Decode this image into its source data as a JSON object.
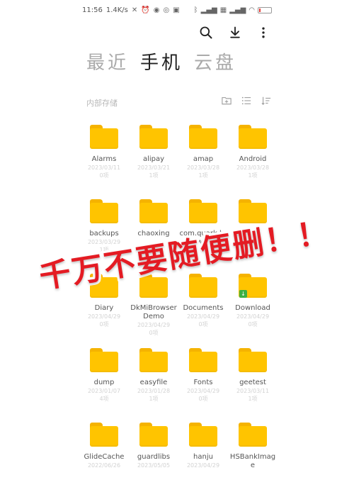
{
  "status_bar": {
    "time": "11:56",
    "speed": "1.4K/s",
    "battery_level": 0.15,
    "battery_color": "#e53935"
  },
  "actions": {
    "search_icon": "search-icon",
    "download_icon": "download-icon",
    "more_icon": "more-vertical-icon"
  },
  "tabs": [
    {
      "label": "最近",
      "active": false
    },
    {
      "label": "手机",
      "active": true
    },
    {
      "label": "云盘",
      "active": false
    }
  ],
  "storage": {
    "label": "内部存储"
  },
  "folders": [
    {
      "name": "Alarms",
      "date": "2023/03/11",
      "count": "0项",
      "badge": ""
    },
    {
      "name": "alipay",
      "date": "2023/03/21",
      "count": "1项",
      "badge": ""
    },
    {
      "name": "amap",
      "date": "2023/03/28",
      "count": "1项",
      "badge": ""
    },
    {
      "name": "Android",
      "date": "2023/03/28",
      "count": "1项",
      "badge": ""
    },
    {
      "name": "backups",
      "date": "2023/03/29",
      "count": "1项",
      "badge": ""
    },
    {
      "name": "chaoxing",
      "date": "",
      "count": "",
      "badge": ""
    },
    {
      "name": "com.quark.browser",
      "date": "",
      "count": "",
      "badge": ""
    },
    {
      "name": "",
      "date": "",
      "count": "",
      "badge": ""
    },
    {
      "name": "Diary",
      "date": "2023/04/29",
      "count": "0项",
      "badge": ""
    },
    {
      "name": "DkMiBrowserDemo",
      "date": "2023/04/29",
      "count": "0项",
      "badge": ""
    },
    {
      "name": "Documents",
      "date": "2023/04/29",
      "count": "0项",
      "badge": ""
    },
    {
      "name": "Download",
      "date": "2023/04/29",
      "count": "0项",
      "badge": "↓"
    },
    {
      "name": "dump",
      "date": "2023/01/07",
      "count": "4项",
      "badge": ""
    },
    {
      "name": "easyfile",
      "date": "2023/01/28",
      "count": "1项",
      "badge": ""
    },
    {
      "name": "Fonts",
      "date": "2023/04/29",
      "count": "0项",
      "badge": ""
    },
    {
      "name": "geetest",
      "date": "2023/03/11",
      "count": "1项",
      "badge": ""
    },
    {
      "name": "GlideCache",
      "date": "2022/06/26",
      "count": "",
      "badge": ""
    },
    {
      "name": "guardlibs",
      "date": "2023/05/05",
      "count": "",
      "badge": ""
    },
    {
      "name": "hanju",
      "date": "2023/04/29",
      "count": "",
      "badge": ""
    },
    {
      "name": "HSBankImage",
      "date": "",
      "count": "",
      "badge": ""
    }
  ],
  "overlay": {
    "text": "千万不要随便删！！",
    "color": "#e41b23"
  }
}
